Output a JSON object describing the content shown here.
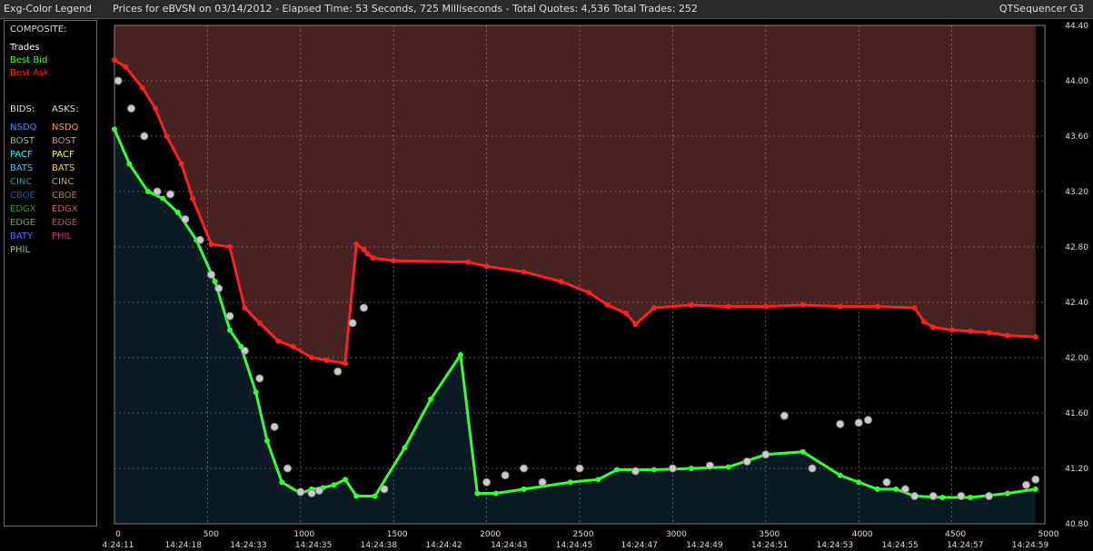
{
  "window": {
    "legend_title": "Exg-Color Legend",
    "header": "Prices for  eBVSN  on  03/14/2012  -  Elapsed Time: 53 Seconds, 725 Milliseconds  -  Total Quotes: 4,536  Total Trades: 252",
    "app_name": "QTSequencer G3"
  },
  "legend": {
    "composite_label": "COMPOSITE:",
    "composite": [
      {
        "label": "Trades",
        "color": "#ffffff"
      },
      {
        "label": "Best Bid",
        "color": "#33ff33"
      },
      {
        "label": "Best Ask",
        "color": "#ff2020"
      }
    ],
    "bids_label": "BIDS:",
    "asks_label": "ASKS:",
    "bids": [
      {
        "label": "NSDQ",
        "color": "#3a8cff"
      },
      {
        "label": "BOST",
        "color": "#8ec07c"
      },
      {
        "label": "PACF",
        "color": "#00ffff"
      },
      {
        "label": "BATS",
        "color": "#40c8ff"
      },
      {
        "label": "CINC",
        "color": "#2a9c9c"
      },
      {
        "label": "CBOE",
        "color": "#1a5cc0"
      },
      {
        "label": "EDGX",
        "color": "#3a9a3a"
      },
      {
        "label": "EDGE",
        "color": "#6aa84f"
      },
      {
        "label": "BATY",
        "color": "#5a6aff"
      },
      {
        "label": "PHIL",
        "color": "#b0c060"
      }
    ],
    "asks": [
      {
        "label": "NSDQ",
        "color": "#ff8c40"
      },
      {
        "label": "BOST",
        "color": "#d09070"
      },
      {
        "label": "PACF",
        "color": "#ffff40"
      },
      {
        "label": "BATS",
        "color": "#ffd040"
      },
      {
        "label": "CINC",
        "color": "#b8a878"
      },
      {
        "label": "CBOE",
        "color": "#c08030"
      },
      {
        "label": "EDGX",
        "color": "#c06060"
      },
      {
        "label": "EDGE",
        "color": "#c05050"
      },
      {
        "label": "PHIL",
        "color": "#c04080"
      }
    ]
  },
  "chart_data": {
    "type": "line",
    "title": "",
    "xlabel": "",
    "ylabel": "",
    "xlim": [
      0,
      5000
    ],
    "ylim": [
      40.8,
      44.4
    ],
    "grid": true,
    "x_ticks": [
      "0",
      "500",
      "1000",
      "1500",
      "2000",
      "2500",
      "3000",
      "3500",
      "4000",
      "4500",
      "5000"
    ],
    "time_ticks": [
      "4:24:11",
      "14:24:18",
      "14:24:33",
      "14:24:35",
      "14:24:38",
      "14:24:42",
      "14:24:43",
      "14:24:45",
      "14:24:47",
      "14:24:49",
      "14:24:51",
      "14:24:53",
      "14:24:55",
      "14:24:57",
      "14:24:59"
    ],
    "y_ticks": [
      "44.40",
      "44.00",
      "43.60",
      "43.20",
      "42.80",
      "42.40",
      "42.00",
      "41.60",
      "41.20",
      "40.80"
    ],
    "series": [
      {
        "name": "Best Ask",
        "color": "#ff2020",
        "x": [
          0,
          60,
          150,
          220,
          280,
          360,
          420,
          520,
          620,
          700,
          780,
          880,
          960,
          1060,
          1140,
          1240,
          1300,
          1340,
          1360,
          1390,
          1500,
          1900,
          2000,
          2200,
          2400,
          2550,
          2650,
          2750,
          2800,
          2900,
          3100,
          3300,
          3500,
          3700,
          3900,
          4100,
          4300,
          4350,
          4400,
          4500,
          4600,
          4700,
          4800,
          4950
        ],
        "y": [
          44.15,
          44.1,
          43.95,
          43.8,
          43.6,
          43.4,
          43.15,
          42.82,
          42.8,
          42.36,
          42.25,
          42.12,
          42.08,
          42.0,
          41.98,
          41.96,
          42.82,
          42.78,
          42.75,
          42.72,
          42.7,
          42.69,
          42.66,
          42.62,
          42.55,
          42.47,
          42.38,
          42.32,
          42.24,
          42.36,
          42.38,
          42.37,
          42.37,
          42.38,
          42.37,
          42.37,
          42.36,
          42.26,
          42.22,
          42.2,
          42.19,
          42.18,
          42.16,
          42.15
        ]
      },
      {
        "name": "Best Bid",
        "color": "#33ff33",
        "x": [
          0,
          80,
          180,
          260,
          340,
          440,
          540,
          620,
          680,
          760,
          820,
          900,
          1000,
          1060,
          1120,
          1180,
          1240,
          1300,
          1400,
          1560,
          1700,
          1860,
          1950,
          2050,
          2200,
          2450,
          2600,
          2700,
          2900,
          3100,
          3300,
          3500,
          3700,
          3900,
          4000,
          4100,
          4200,
          4300,
          4450,
          4600,
          4800,
          4950
        ],
        "y": [
          43.65,
          43.4,
          43.2,
          43.15,
          43.05,
          42.85,
          42.55,
          42.2,
          42.08,
          41.75,
          41.4,
          41.1,
          41.02,
          41.05,
          41.06,
          41.08,
          41.12,
          41.0,
          41.0,
          41.35,
          41.7,
          42.02,
          41.02,
          41.02,
          41.05,
          41.1,
          41.12,
          41.19,
          41.19,
          41.2,
          41.21,
          41.3,
          41.32,
          41.15,
          41.1,
          41.05,
          41.05,
          41.0,
          40.99,
          40.99,
          41.02,
          41.05
        ]
      },
      {
        "name": "Trades",
        "color": "#ffffff",
        "x": [
          20,
          90,
          160,
          230,
          300,
          380,
          460,
          520,
          560,
          620,
          700,
          780,
          860,
          930,
          1000,
          1060,
          1100,
          1200,
          1280,
          1340,
          1450,
          2000,
          2100,
          2200,
          2300,
          2500,
          2800,
          3000,
          3200,
          3400,
          3500,
          3600,
          3750,
          3900,
          4000,
          4050,
          4150,
          4250,
          4300,
          4400,
          4550,
          4700,
          4900,
          4950
        ],
        "y": [
          44.0,
          43.8,
          43.6,
          43.2,
          43.18,
          43.0,
          42.85,
          42.6,
          42.5,
          42.3,
          42.05,
          41.85,
          41.5,
          41.2,
          41.03,
          41.02,
          41.04,
          41.9,
          42.25,
          42.36,
          41.05,
          41.1,
          41.15,
          41.2,
          41.1,
          41.2,
          41.18,
          41.2,
          41.22,
          41.25,
          41.3,
          41.58,
          41.2,
          41.52,
          41.53,
          41.55,
          41.1,
          41.05,
          41.0,
          41.0,
          41.0,
          41.0,
          41.08,
          41.12
        ]
      }
    ]
  }
}
